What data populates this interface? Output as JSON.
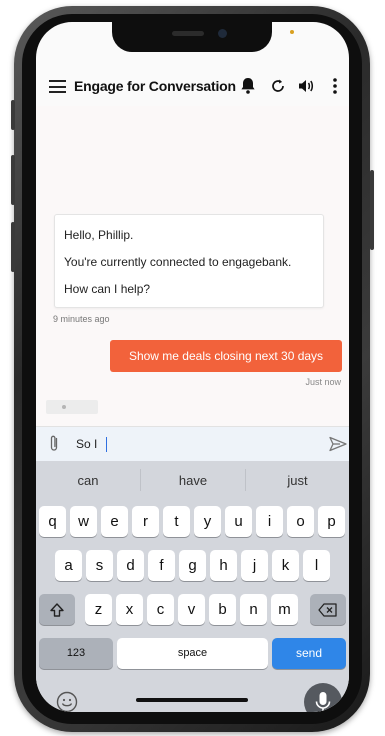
{
  "header": {
    "title": "Engage for Conversation",
    "icons": [
      "menu-icon",
      "bell-icon",
      "refresh-icon",
      "speaker-icon",
      "more-vertical-icon"
    ]
  },
  "chat": {
    "bot_message": {
      "line1": "Hello, Phillip.",
      "line2": "You're currently connected to engagebank.",
      "line3": "How can I help?",
      "timestamp": "9 minutes ago"
    },
    "user_message": {
      "text": "Show me deals closing next 30 days",
      "timestamp": "Just now"
    }
  },
  "composer": {
    "value": "So I",
    "icons": [
      "paperclip-icon",
      "send-icon"
    ]
  },
  "keyboard": {
    "suggestions": [
      "can",
      "have",
      "just"
    ],
    "row1": [
      "q",
      "w",
      "e",
      "r",
      "t",
      "y",
      "u",
      "i",
      "o",
      "p"
    ],
    "row2": [
      "a",
      "s",
      "d",
      "f",
      "g",
      "h",
      "j",
      "k",
      "l"
    ],
    "row3": [
      "z",
      "x",
      "c",
      "v",
      "b",
      "n",
      "m"
    ],
    "numbers_label": "123",
    "space_label": "space",
    "send_label": "send"
  },
  "colors": {
    "accent": "#f2623b",
    "send_key": "#2f86e8"
  }
}
